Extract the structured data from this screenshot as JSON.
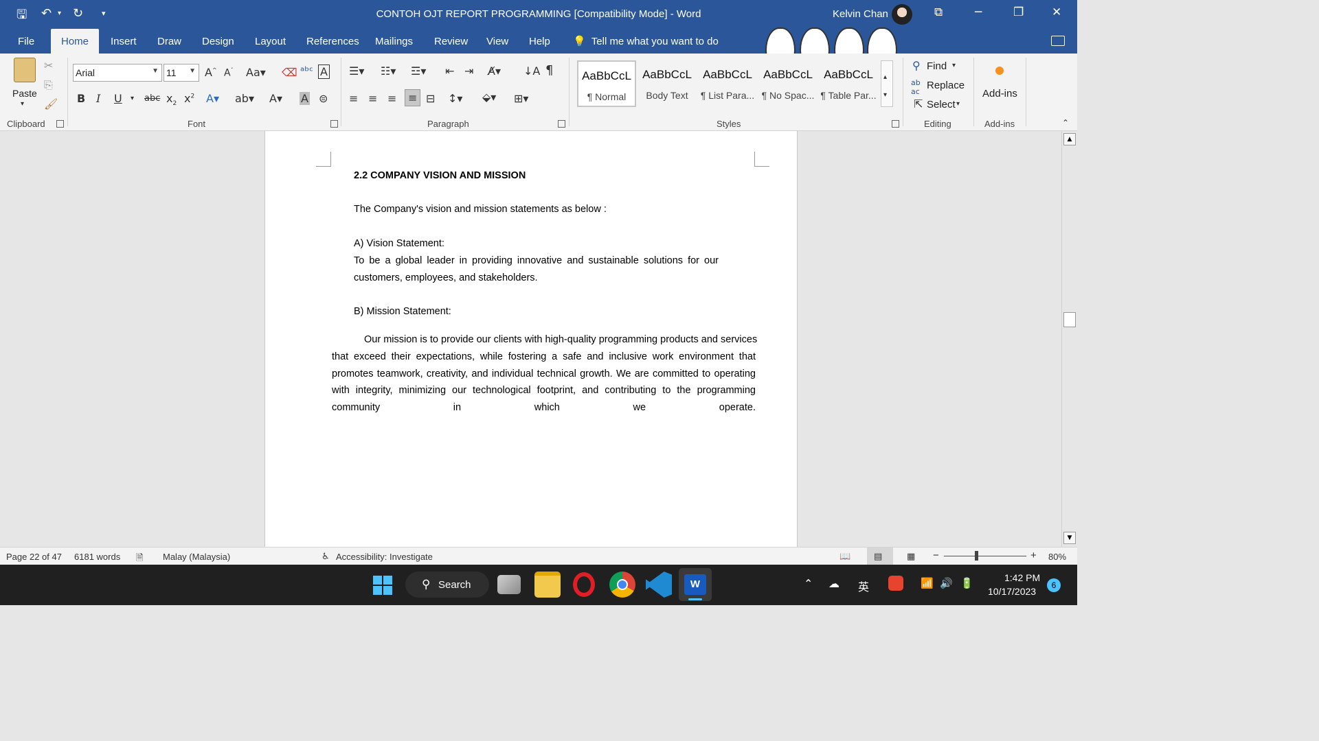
{
  "titlebar": {
    "title": "CONTOH OJT REPORT PROGRAMMING [Compatibility Mode]  -  Word",
    "user": "Kelvin Chan"
  },
  "tabs": [
    "File",
    "Home",
    "Insert",
    "Draw",
    "Design",
    "Layout",
    "References",
    "Mailings",
    "Review",
    "View",
    "Help"
  ],
  "tell_me": "Tell me what you want to do",
  "ribbon": {
    "clipboard": {
      "paste": "Paste",
      "label": "Clipboard"
    },
    "font": {
      "name": "Arial",
      "size": "11",
      "label": "Font"
    },
    "paragraph": {
      "label": "Paragraph"
    },
    "styles": {
      "label": "Styles",
      "items": [
        {
          "preview": "AaBbCcL",
          "name": "¶ Normal"
        },
        {
          "preview": "AaBbCcL",
          "name": "Body Text"
        },
        {
          "preview": "AaBbCcL",
          "name": "¶ List Para..."
        },
        {
          "preview": "AaBbCcL",
          "name": "¶ No Spac..."
        },
        {
          "preview": "AaBbCcL",
          "name": "¶ Table Par..."
        }
      ]
    },
    "editing": {
      "find": "Find",
      "replace": "Replace",
      "select": "Select",
      "label": "Editing"
    },
    "addins": {
      "button": "Add-ins",
      "label": "Add-ins"
    }
  },
  "document": {
    "heading": "2.2 COMPANY VISION AND MISSION",
    "intro": "The Company's vision and mission statements as below :",
    "vision_heading": "A) Vision Statement:",
    "vision_line1": "To be a global leader in providing innovative and sustainable solutions for our",
    "vision_line2": "customers, employees, and stakeholders.",
    "mission_heading": "B) Mission Statement:",
    "mission_lines": [
      "Our mission is to provide our clients with high-quality programming products and services",
      "that exceed their expectations, while fostering a safe and inclusive work environment that",
      "promotes teamwork, creativity, and individual technical growth. We are committed to operating",
      "with integrity, minimizing our technological footprint, and contributing to the programming",
      "community in which we operate."
    ]
  },
  "status": {
    "page": "Page 22 of 47",
    "words": "6181 words",
    "language": "Malay (Malaysia)",
    "accessibility": "Accessibility: Investigate",
    "zoom": "80%"
  },
  "taskbar": {
    "search": "Search",
    "time": "1:42 PM",
    "date": "10/17/2023",
    "ime": "英",
    "notifications": "6"
  }
}
